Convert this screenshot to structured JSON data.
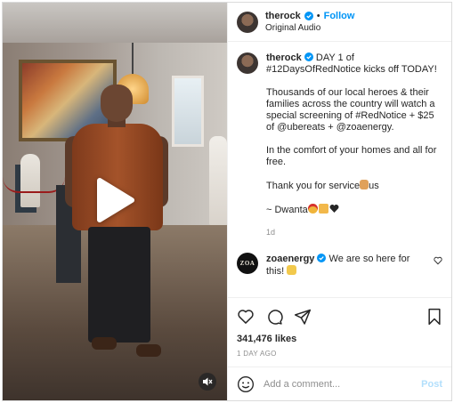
{
  "author": {
    "username": "therock",
    "audio": "Original Audio",
    "follow_label": "Follow",
    "separator": "•"
  },
  "caption": {
    "username": "therock",
    "line1": "DAY 1 of #12DaysOfRedNotice kicks off TODAY!",
    "para2": "Thousands of our local heroes & their families across the country will watch a special screening of #RedNotice + $25 of @ubereats + @zoaenergy.",
    "para3": "In the comfort of your homes and all for free.",
    "para4_text": "Thank you for service",
    "para4_tail": "us",
    "signoff": "~ Dwanta",
    "time": "1d"
  },
  "reply": {
    "username": "zoaenergy",
    "avatar_text": "ZOA",
    "text": "We are so here for this!"
  },
  "stats": {
    "likes": "341,476 likes",
    "ago": "1 DAY AGO"
  },
  "composer": {
    "placeholder": "Add a comment...",
    "post_label": "Post"
  },
  "colors": {
    "accent": "#0095f6",
    "post_disabled": "#b2dffc",
    "muted": "#8e8e8e"
  }
}
